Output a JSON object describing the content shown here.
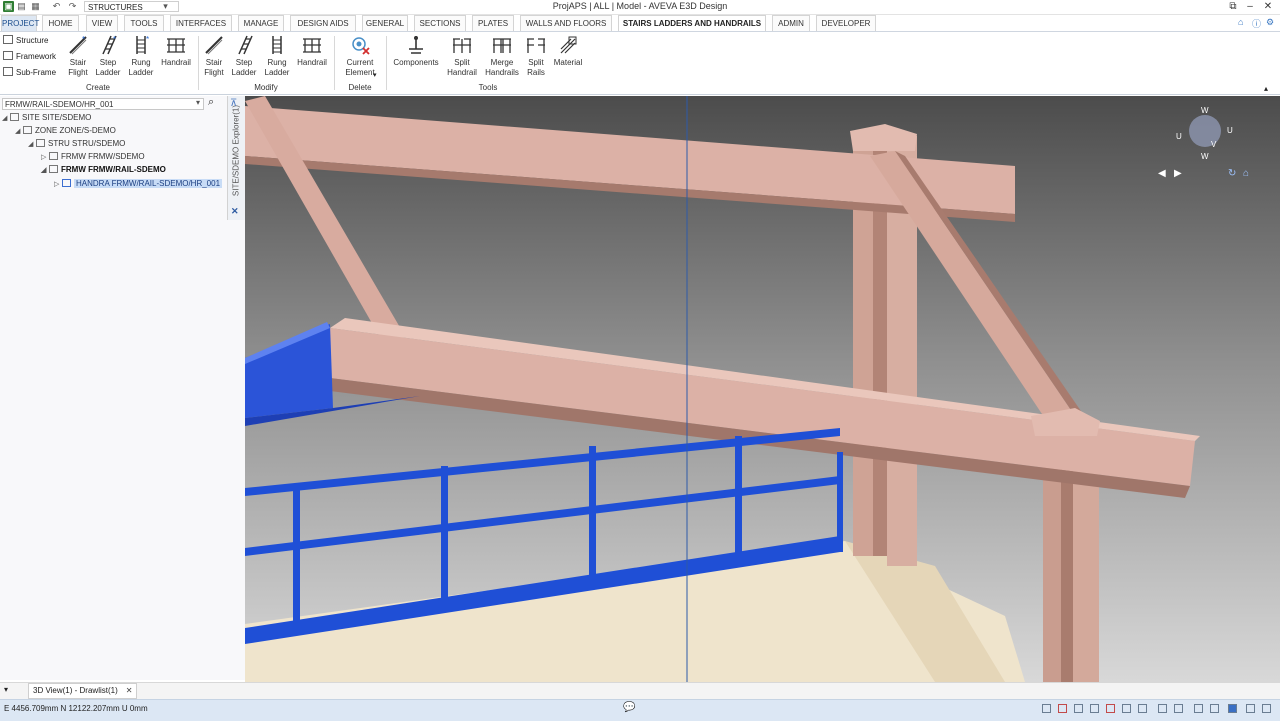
{
  "window": {
    "title": "ProjAPS | ALL | Model - AVEVA E3D Design",
    "context": "STRUCTURES"
  },
  "tabs": [
    "PROJECT",
    "HOME",
    "VIEW",
    "TOOLS",
    "INTERFACES",
    "MANAGE",
    "DESIGN AIDS",
    "GENERAL",
    "SECTIONS",
    "PLATES",
    "WALLS AND FLOORS",
    "STAIRS LADDERS AND HANDRAILS",
    "ADMIN",
    "DEVELOPER"
  ],
  "ribbon": {
    "side_items": [
      "Structure",
      "Framework",
      "Sub-Frame"
    ],
    "create": {
      "label": "Create",
      "stair_flight": "Stair Flight",
      "step_ladder": "Step Ladder",
      "rung_ladder": "Rung Ladder",
      "handrail": "Handrail"
    },
    "modify": {
      "label": "Modify",
      "stair_flight": "Stair Flight",
      "step_ladder": "Step Ladder",
      "rung_ladder": "Rung Ladder",
      "handrail": "Handrail"
    },
    "delete": {
      "label": "Delete",
      "current_element": "Current Element"
    },
    "tools": {
      "label": "Tools",
      "components": "Components",
      "split_handrail": "Split Handrail",
      "merge_handrails": "Merge Handrails",
      "split_rails": "Split Rails",
      "material": "Material"
    }
  },
  "explorer": {
    "path": "FRMW/RAIL-SDEMO/HR_001",
    "title": "SITE/SDEMO Explorer(1)",
    "tree": [
      {
        "label": "SITE SITE/SDEMO"
      },
      {
        "label": "ZONE ZONE/S-DEMO"
      },
      {
        "label": "STRU STRU/SDEMO"
      },
      {
        "label": "FRMW FRMW/SDEMO"
      },
      {
        "label": "FRMW FRMW/RAIL-SDEMO"
      },
      {
        "label": "HANDRA FRMW/RAIL-SDEMO/HR_001"
      }
    ]
  },
  "navcube": {
    "labels": [
      "W",
      "U",
      "U",
      "V",
      "W"
    ]
  },
  "doctab": {
    "label": "3D View(1) - Drawlist(1)"
  },
  "status": {
    "coords": "E 4456.709mm N 12122.207mm U 0mm"
  },
  "colors": {
    "steel": "#dcb1a6",
    "handrail": "#1f4fd6",
    "accent": "#1c4e8e"
  }
}
